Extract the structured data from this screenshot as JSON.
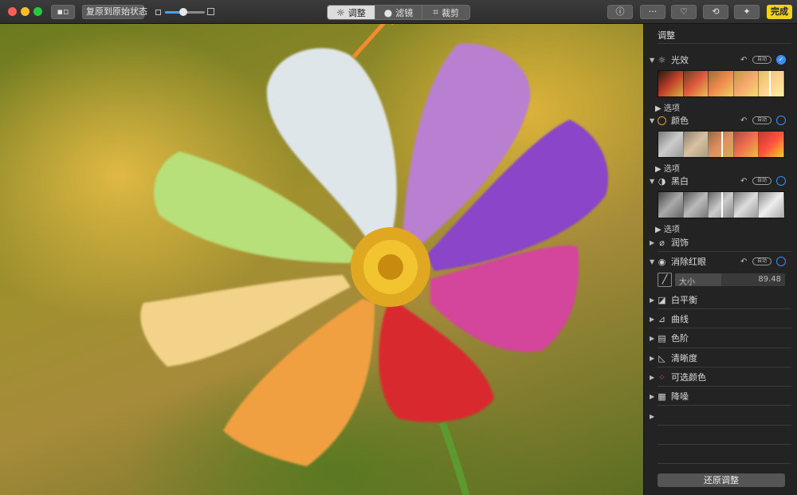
{
  "toolbar": {
    "revert_label": "复原到原始状态",
    "zoom_level": 0.45,
    "tabs": [
      {
        "label": "调整",
        "icon": "sun-icon",
        "active": true
      },
      {
        "label": "滤镜",
        "icon": "filters-icon",
        "active": false
      },
      {
        "label": "裁剪",
        "icon": "crop-icon",
        "active": false
      }
    ],
    "info_icon": "ⓘ",
    "more_icon": "···",
    "favorite_icon": "♡",
    "rotate_icon": "⟲",
    "enhance_icon": "✦",
    "done_label": "完成",
    "done_color": "#f2d220"
  },
  "sidebar": {
    "title": "调整",
    "sections": {
      "light": {
        "label": "光效",
        "auto": "自动",
        "options": "选项",
        "enabled": true
      },
      "color": {
        "label": "颜色",
        "auto": "自动",
        "options": "选项"
      },
      "bw": {
        "label": "黑白",
        "auto": "自动",
        "options": "选项"
      },
      "retouch": {
        "label": "润饰"
      },
      "redeye": {
        "label": "消除红眼",
        "auto": "自动",
        "size_label": "大小",
        "size_value": "89.48"
      },
      "white_balance": {
        "label": "白平衡"
      },
      "curves": {
        "label": "曲线"
      },
      "levels": {
        "label": "色阶"
      },
      "definition": {
        "label": "清晰度"
      },
      "selective_color": {
        "label": "可选颜色"
      },
      "noise_reduction": {
        "label": "降噪"
      }
    },
    "revert_adjustments_label": "还原调整",
    "accent_color": "#3d8ef0"
  },
  "annotation": {
    "arrow_color": "#f28a2e"
  }
}
